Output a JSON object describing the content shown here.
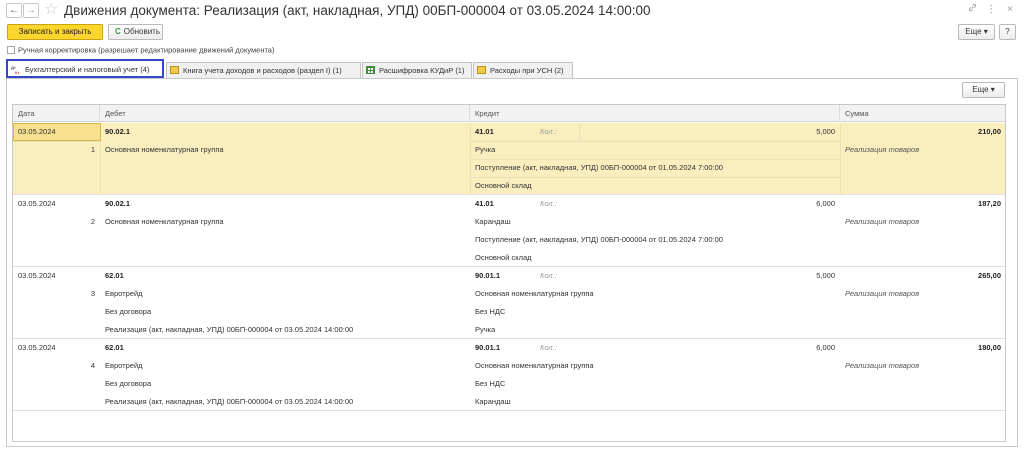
{
  "window": {
    "title": "Движения документа: Реализация (акт, накладная, УПД) 00БП-000004 от 03.05.2024 14:00:00",
    "nav_back": "←",
    "nav_forward": "→",
    "star": "☆",
    "link_icon": "🔗",
    "menu_icon": "⋮",
    "close_icon": "×"
  },
  "toolbar": {
    "save_close": "Записать и закрыть",
    "refresh": "Обновить",
    "refresh_icon": "C",
    "more": "Еще",
    "help": "?"
  },
  "manual_edit": {
    "label": "Ручная корректировка (разрешает редактирование движений документа)",
    "checked": false
  },
  "tabs": [
    {
      "label": "Бухгалтерский и налоговый учет (4)",
      "icon": "dt-kt-icon",
      "active": true
    },
    {
      "label": "Книга учета доходов и расходов (раздел I) (1)",
      "icon": "register-book-icon",
      "active": false
    },
    {
      "label": "Расшифровка КУДиР (1)",
      "icon": "table-grid-icon",
      "active": false
    },
    {
      "label": "Расходы при УСН (2)",
      "icon": "register-book-icon",
      "active": false
    }
  ],
  "panel": {
    "more": "Еще"
  },
  "columns": {
    "date": "Дата",
    "debit": "Дебет",
    "credit": "Кредит",
    "sum": "Сумма"
  },
  "records": [
    {
      "date": "03.05.2024",
      "num": "1",
      "debit_account": "90.02.1",
      "debit_sub": [
        "Основная номенклатурная группа"
      ],
      "credit_account": "41.01",
      "qty_label": "Кол.:",
      "qty": "5,000",
      "credit_sub": [
        "Ручка",
        "Поступление (акт, накладная, УПД) 00БП-000004 от 01.05.2024 7:00:00",
        "Основной склад"
      ],
      "sum": "210,00",
      "content": "Реализация товаров"
    },
    {
      "date": "03.05.2024",
      "num": "2",
      "debit_account": "90.02.1",
      "debit_sub": [
        "Основная номенклатурная группа"
      ],
      "credit_account": "41.01",
      "qty_label": "Кол.:",
      "qty": "6,000",
      "credit_sub": [
        "Карандаш",
        "Поступление (акт, накладная, УПД) 00БП-000004 от 01.05.2024 7:00:00",
        "Основной склад"
      ],
      "sum": "187,20",
      "content": "Реализация товаров"
    },
    {
      "date": "03.05.2024",
      "num": "3",
      "debit_account": "62.01",
      "debit_sub": [
        "Евротрейд",
        "Без договора",
        "Реализация (акт, накладная, УПД) 00БП-000004 от 03.05.2024 14:00:00"
      ],
      "credit_account": "90.01.1",
      "qty_label": "Кол.:",
      "qty": "5,000",
      "credit_sub": [
        "Основная номенклатурная группа",
        "Без НДС",
        "Ручка"
      ],
      "sum": "265,00",
      "content": "Реализация товаров"
    },
    {
      "date": "03.05.2024",
      "num": "4",
      "debit_account": "62.01",
      "debit_sub": [
        "Евротрейд",
        "Без договора",
        "Реализация (акт, накладная, УПД) 00БП-000004 от 03.05.2024 14:00:00"
      ],
      "credit_account": "90.01.1",
      "qty_label": "Кол.:",
      "qty": "6,000",
      "credit_sub": [
        "Основная номенклатурная группа",
        "Без НДС",
        "Карандаш"
      ],
      "sum": "180,00",
      "content": "Реализация товаров"
    }
  ]
}
